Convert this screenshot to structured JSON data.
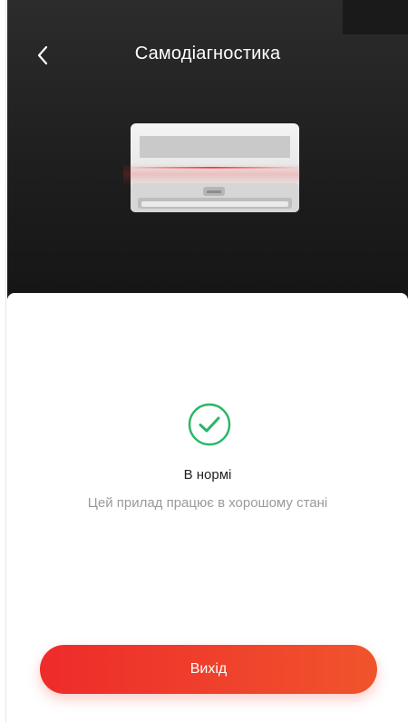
{
  "header": {
    "title": "Самодіагностика",
    "back_icon": "chevron-left-icon"
  },
  "status": {
    "icon": "check-circle-icon",
    "title": "В нормі",
    "description": "Цей прилад працює в хорошому стані",
    "accent_color": "#2ab567"
  },
  "actions": {
    "exit_label": "Вихід",
    "button_gradient_start": "#ee2b2b",
    "button_gradient_end": "#f0542c"
  },
  "theme": {
    "header_background": "#1e1e1e",
    "scan_line_color": "#ff2a2a"
  }
}
